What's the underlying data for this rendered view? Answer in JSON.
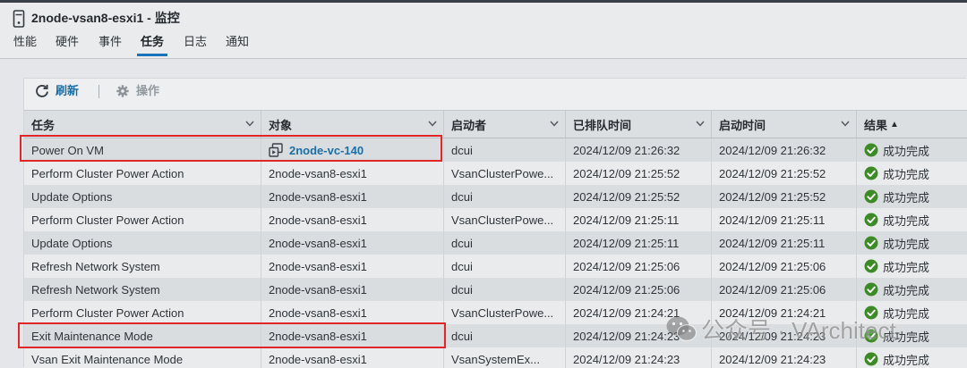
{
  "window": {
    "title": "2node-vsan8-esxi1 - 监控",
    "icon": "host-icon"
  },
  "tabs": [
    {
      "label": "性能",
      "active": false
    },
    {
      "label": "硬件",
      "active": false
    },
    {
      "label": "事件",
      "active": false
    },
    {
      "label": "任务",
      "active": true
    },
    {
      "label": "日志",
      "active": false
    },
    {
      "label": "通知",
      "active": false
    }
  ],
  "toolbar": {
    "refresh": {
      "label": "刷新",
      "icon": "refresh-icon",
      "enabled": true
    },
    "actions": {
      "label": "操作",
      "icon": "gear-icon",
      "enabled": false
    }
  },
  "table": {
    "columns": [
      {
        "label": "任务",
        "menu_icon": "chevron-down-icon"
      },
      {
        "label": "对象",
        "menu_icon": "chevron-down-icon"
      },
      {
        "label": "启动者",
        "menu_icon": "chevron-down-icon"
      },
      {
        "label": "已排队时间",
        "menu_icon": "chevron-down-icon"
      },
      {
        "label": "启动时间",
        "menu_icon": "chevron-down-icon"
      },
      {
        "label": "结果",
        "sort_indicator": "▲"
      }
    ],
    "rows": [
      {
        "task": "Power On VM",
        "object": "2node-vc-140",
        "object_icon": "vm-icon",
        "initiator": "dcui",
        "queued": "2024/12/09 21:26:32",
        "started": "2024/12/09 21:26:32",
        "result": "成功完成",
        "result_icon": "success-check-icon",
        "highlighted": true
      },
      {
        "task": "Perform Cluster Power Action",
        "object": "2node-vsan8-esxi1",
        "initiator": "VsanClusterPowe...",
        "queued": "2024/12/09 21:25:52",
        "started": "2024/12/09 21:25:52",
        "result": "成功完成",
        "result_icon": "success-check-icon"
      },
      {
        "task": "Update Options",
        "object": "2node-vsan8-esxi1",
        "initiator": "dcui",
        "queued": "2024/12/09 21:25:52",
        "started": "2024/12/09 21:25:52",
        "result": "成功完成",
        "result_icon": "success-check-icon"
      },
      {
        "task": "Perform Cluster Power Action",
        "object": "2node-vsan8-esxi1",
        "initiator": "VsanClusterPowe...",
        "queued": "2024/12/09 21:25:11",
        "started": "2024/12/09 21:25:11",
        "result": "成功完成",
        "result_icon": "success-check-icon"
      },
      {
        "task": "Update Options",
        "object": "2node-vsan8-esxi1",
        "initiator": "dcui",
        "queued": "2024/12/09 21:25:11",
        "started": "2024/12/09 21:25:11",
        "result": "成功完成",
        "result_icon": "success-check-icon"
      },
      {
        "task": "Refresh Network System",
        "object": "2node-vsan8-esxi1",
        "initiator": "dcui",
        "queued": "2024/12/09 21:25:06",
        "started": "2024/12/09 21:25:06",
        "result": "成功完成",
        "result_icon": "success-check-icon"
      },
      {
        "task": "Refresh Network System",
        "object": "2node-vsan8-esxi1",
        "initiator": "dcui",
        "queued": "2024/12/09 21:25:06",
        "started": "2024/12/09 21:25:06",
        "result": "成功完成",
        "result_icon": "success-check-icon"
      },
      {
        "task": "Perform Cluster Power Action",
        "object": "2node-vsan8-esxi1",
        "initiator": "VsanClusterPowe...",
        "queued": "2024/12/09 21:24:21",
        "started": "2024/12/09 21:24:21",
        "result": "成功完成",
        "result_icon": "success-check-icon"
      },
      {
        "task": "Exit Maintenance Mode",
        "object": "2node-vsan8-esxi1",
        "initiator": "dcui",
        "queued": "2024/12/09 21:24:23",
        "started": "2024/12/09 21:24:23",
        "result": "成功完成",
        "result_icon": "success-check-icon",
        "highlighted": true
      },
      {
        "task": "Vsan Exit Maintenance Mode",
        "object": "2node-vsan8-esxi1",
        "initiator": "VsanSystemEx...",
        "queued": "2024/12/09 21:24:23",
        "started": "2024/12/09 21:24:23",
        "result": "成功完成",
        "result_icon": "success-check-icon"
      }
    ]
  },
  "watermark": {
    "icon": "wechat-icon",
    "text": "公众号 · VArchitect"
  },
  "colors": {
    "accent_blue": "#1c6ea4",
    "active_tab_underline": "#1a73b8",
    "success_green": "#3d8b26",
    "annotation_red": "#e02626",
    "disabled_gray": "#939aa1"
  }
}
